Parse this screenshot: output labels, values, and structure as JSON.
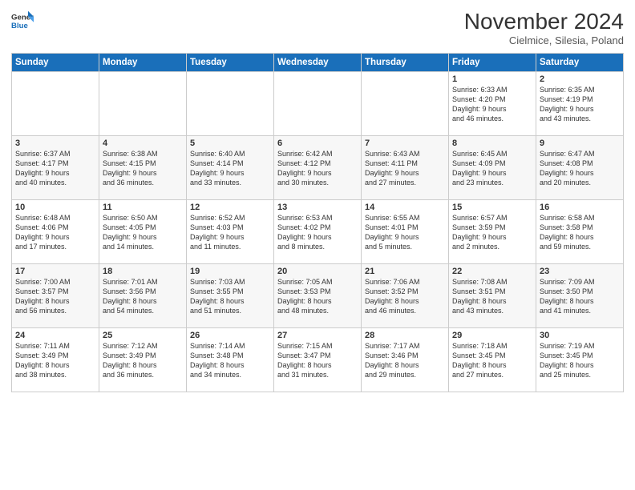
{
  "header": {
    "logo_line1": "General",
    "logo_line2": "Blue",
    "title": "November 2024",
    "subtitle": "Cielmice, Silesia, Poland"
  },
  "weekdays": [
    "Sunday",
    "Monday",
    "Tuesday",
    "Wednesday",
    "Thursday",
    "Friday",
    "Saturday"
  ],
  "weeks": [
    [
      {
        "day": "",
        "info": ""
      },
      {
        "day": "",
        "info": ""
      },
      {
        "day": "",
        "info": ""
      },
      {
        "day": "",
        "info": ""
      },
      {
        "day": "",
        "info": ""
      },
      {
        "day": "1",
        "info": "Sunrise: 6:33 AM\nSunset: 4:20 PM\nDaylight: 9 hours\nand 46 minutes."
      },
      {
        "day": "2",
        "info": "Sunrise: 6:35 AM\nSunset: 4:19 PM\nDaylight: 9 hours\nand 43 minutes."
      }
    ],
    [
      {
        "day": "3",
        "info": "Sunrise: 6:37 AM\nSunset: 4:17 PM\nDaylight: 9 hours\nand 40 minutes."
      },
      {
        "day": "4",
        "info": "Sunrise: 6:38 AM\nSunset: 4:15 PM\nDaylight: 9 hours\nand 36 minutes."
      },
      {
        "day": "5",
        "info": "Sunrise: 6:40 AM\nSunset: 4:14 PM\nDaylight: 9 hours\nand 33 minutes."
      },
      {
        "day": "6",
        "info": "Sunrise: 6:42 AM\nSunset: 4:12 PM\nDaylight: 9 hours\nand 30 minutes."
      },
      {
        "day": "7",
        "info": "Sunrise: 6:43 AM\nSunset: 4:11 PM\nDaylight: 9 hours\nand 27 minutes."
      },
      {
        "day": "8",
        "info": "Sunrise: 6:45 AM\nSunset: 4:09 PM\nDaylight: 9 hours\nand 23 minutes."
      },
      {
        "day": "9",
        "info": "Sunrise: 6:47 AM\nSunset: 4:08 PM\nDaylight: 9 hours\nand 20 minutes."
      }
    ],
    [
      {
        "day": "10",
        "info": "Sunrise: 6:48 AM\nSunset: 4:06 PM\nDaylight: 9 hours\nand 17 minutes."
      },
      {
        "day": "11",
        "info": "Sunrise: 6:50 AM\nSunset: 4:05 PM\nDaylight: 9 hours\nand 14 minutes."
      },
      {
        "day": "12",
        "info": "Sunrise: 6:52 AM\nSunset: 4:03 PM\nDaylight: 9 hours\nand 11 minutes."
      },
      {
        "day": "13",
        "info": "Sunrise: 6:53 AM\nSunset: 4:02 PM\nDaylight: 9 hours\nand 8 minutes."
      },
      {
        "day": "14",
        "info": "Sunrise: 6:55 AM\nSunset: 4:01 PM\nDaylight: 9 hours\nand 5 minutes."
      },
      {
        "day": "15",
        "info": "Sunrise: 6:57 AM\nSunset: 3:59 PM\nDaylight: 9 hours\nand 2 minutes."
      },
      {
        "day": "16",
        "info": "Sunrise: 6:58 AM\nSunset: 3:58 PM\nDaylight: 8 hours\nand 59 minutes."
      }
    ],
    [
      {
        "day": "17",
        "info": "Sunrise: 7:00 AM\nSunset: 3:57 PM\nDaylight: 8 hours\nand 56 minutes."
      },
      {
        "day": "18",
        "info": "Sunrise: 7:01 AM\nSunset: 3:56 PM\nDaylight: 8 hours\nand 54 minutes."
      },
      {
        "day": "19",
        "info": "Sunrise: 7:03 AM\nSunset: 3:55 PM\nDaylight: 8 hours\nand 51 minutes."
      },
      {
        "day": "20",
        "info": "Sunrise: 7:05 AM\nSunset: 3:53 PM\nDaylight: 8 hours\nand 48 minutes."
      },
      {
        "day": "21",
        "info": "Sunrise: 7:06 AM\nSunset: 3:52 PM\nDaylight: 8 hours\nand 46 minutes."
      },
      {
        "day": "22",
        "info": "Sunrise: 7:08 AM\nSunset: 3:51 PM\nDaylight: 8 hours\nand 43 minutes."
      },
      {
        "day": "23",
        "info": "Sunrise: 7:09 AM\nSunset: 3:50 PM\nDaylight: 8 hours\nand 41 minutes."
      }
    ],
    [
      {
        "day": "24",
        "info": "Sunrise: 7:11 AM\nSunset: 3:49 PM\nDaylight: 8 hours\nand 38 minutes."
      },
      {
        "day": "25",
        "info": "Sunrise: 7:12 AM\nSunset: 3:49 PM\nDaylight: 8 hours\nand 36 minutes."
      },
      {
        "day": "26",
        "info": "Sunrise: 7:14 AM\nSunset: 3:48 PM\nDaylight: 8 hours\nand 34 minutes."
      },
      {
        "day": "27",
        "info": "Sunrise: 7:15 AM\nSunset: 3:47 PM\nDaylight: 8 hours\nand 31 minutes."
      },
      {
        "day": "28",
        "info": "Sunrise: 7:17 AM\nSunset: 3:46 PM\nDaylight: 8 hours\nand 29 minutes."
      },
      {
        "day": "29",
        "info": "Sunrise: 7:18 AM\nSunset: 3:45 PM\nDaylight: 8 hours\nand 27 minutes."
      },
      {
        "day": "30",
        "info": "Sunrise: 7:19 AM\nSunset: 3:45 PM\nDaylight: 8 hours\nand 25 minutes."
      }
    ]
  ]
}
